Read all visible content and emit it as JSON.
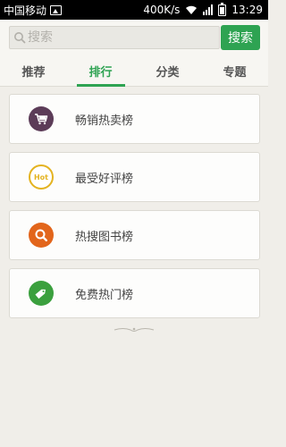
{
  "status_bar": {
    "carrier": "中国移动",
    "speed": "400K/s",
    "time": "13:29"
  },
  "search": {
    "placeholder": "搜索",
    "button_label": "搜索"
  },
  "tabs": [
    {
      "label": "推荐",
      "active": false
    },
    {
      "label": "排行",
      "active": true
    },
    {
      "label": "分类",
      "active": false
    },
    {
      "label": "专题",
      "active": false
    }
  ],
  "rankings": [
    {
      "label": "畅销热卖榜",
      "icon": "shopping-cart-icon",
      "color": "#5c3c58"
    },
    {
      "label": "最受好评榜",
      "icon": "hot-badge-icon",
      "icon_text": "Hot",
      "color": "#e4b320"
    },
    {
      "label": "热搜图书榜",
      "icon": "magnifier-icon",
      "color": "#e2651b"
    },
    {
      "label": "免费热门榜",
      "icon": "free-tag-icon",
      "color": "#3ba03e"
    }
  ],
  "colors": {
    "accent": "#2ea352",
    "background": "#f0eee9"
  }
}
